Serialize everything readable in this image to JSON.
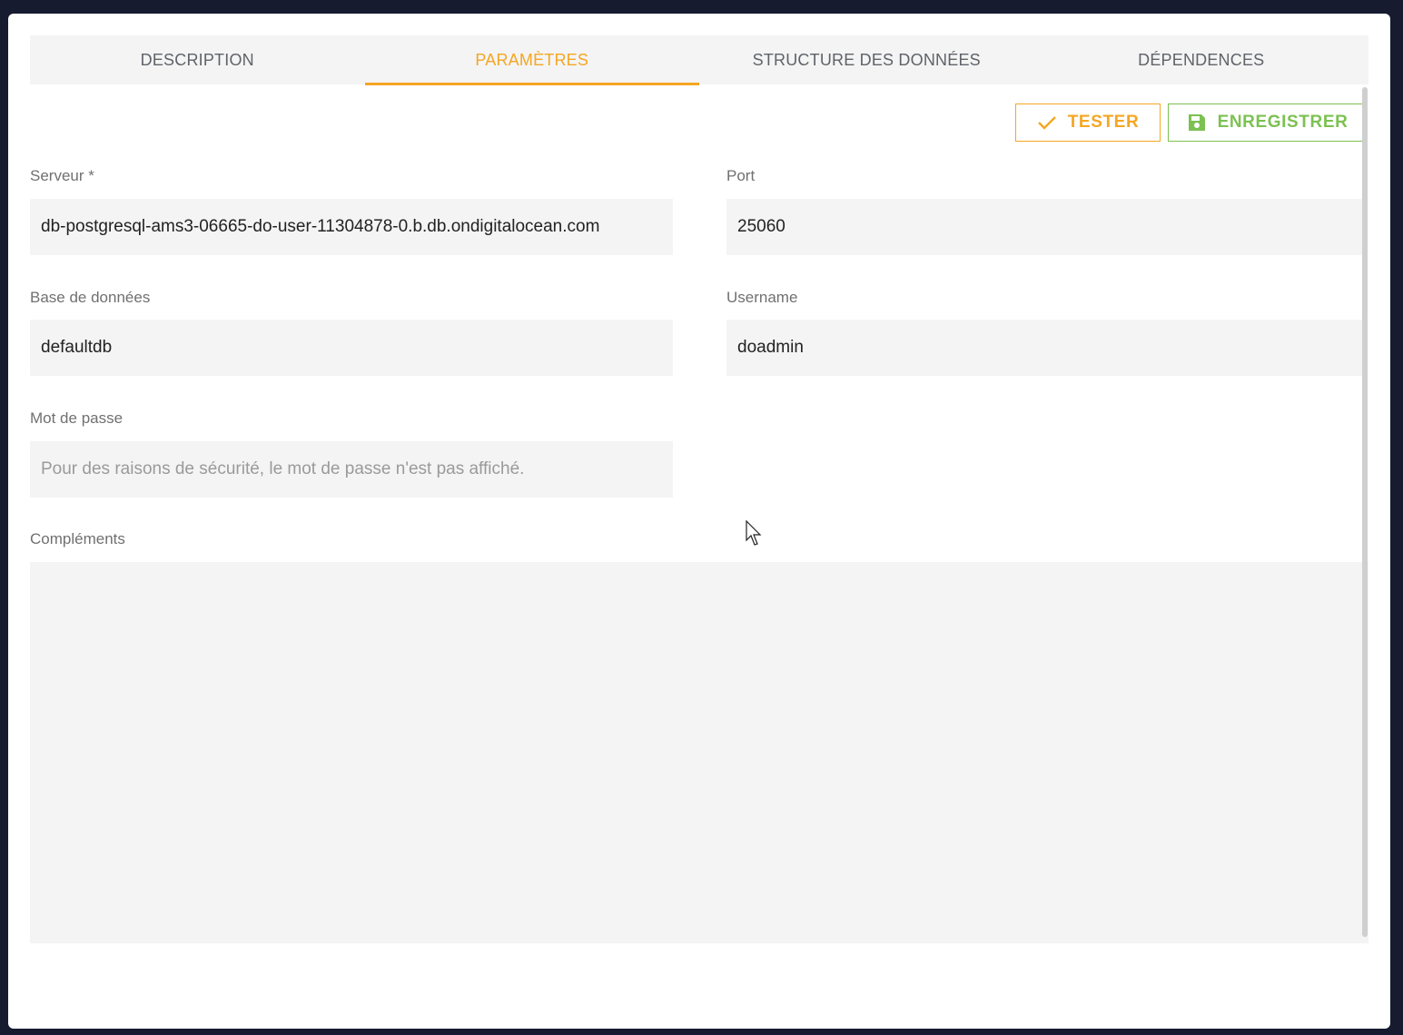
{
  "tabs": [
    {
      "label": "DESCRIPTION",
      "active": false
    },
    {
      "label": "PARAMÈTRES",
      "active": true
    },
    {
      "label": "STRUCTURE DES DONNÉES",
      "active": false
    },
    {
      "label": "DÉPENDENCES",
      "active": false
    }
  ],
  "actions": {
    "test_label": "TESTER",
    "test_icon": "check-icon",
    "save_label": "ENREGISTRER",
    "save_icon": "floppy-disk-icon"
  },
  "form": {
    "server": {
      "label": "Serveur *",
      "value": "db-postgresql-ams3-06665-do-user-11304878-0.b.db.ondigitalocean.com"
    },
    "port": {
      "label": "Port",
      "value": "25060"
    },
    "database": {
      "label": "Base de données",
      "value": "defaultdb"
    },
    "username": {
      "label": "Username",
      "value": "doadmin"
    },
    "password": {
      "label": "Mot de passe",
      "placeholder": "Pour des raisons de sécurité, le mot de passe n'est pas affiché."
    },
    "complements": {
      "label": "Compléments",
      "value": ""
    }
  },
  "colors": {
    "accent": "#f5a623",
    "save": "#7cc152",
    "field_bg": "#f4f4f4",
    "backdrop": "#161b30"
  }
}
